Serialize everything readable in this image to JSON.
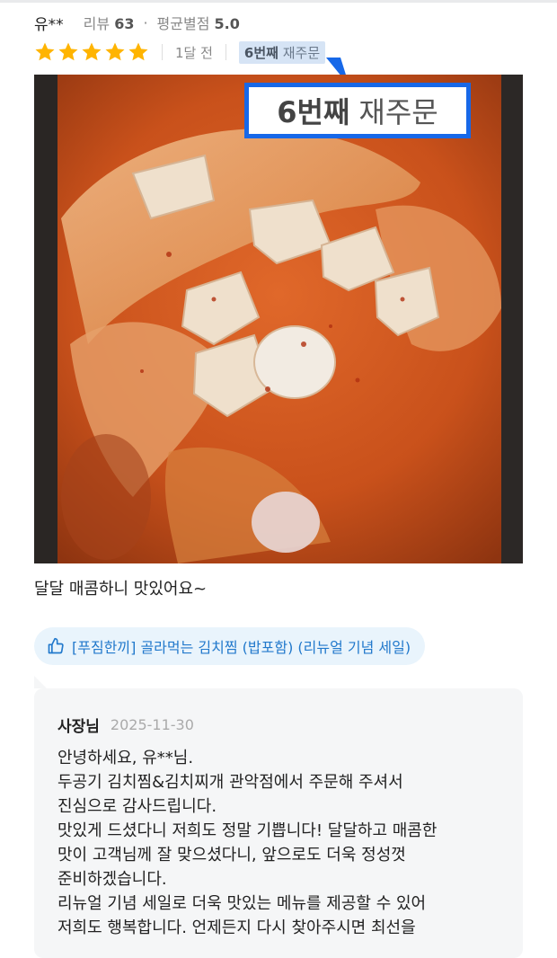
{
  "review": {
    "nickname": "유**",
    "review_count_label": "리뷰",
    "review_count": "63",
    "avg_rating_label": "평균별점",
    "avg_rating": "5.0",
    "stars": 5,
    "star_color": "#ffb400",
    "time_ago": "1달 전",
    "reorder_count": "6번째",
    "reorder_label": "재주문",
    "text": "달달 매콤하니 맛있어요~"
  },
  "menu_chip": {
    "label": "[푸짐한끼] 골라먹는 김치찜 (밥포함) (리뉴얼 기념 세일)",
    "icon": "thumbs-up-icon"
  },
  "reply": {
    "author": "사장님",
    "date": "2025-11-30",
    "lines": [
      "안녕하세요, 유**님.",
      "두공기 김치찜&김치찌개 관악점에서 주문해 주셔서",
      "진심으로 감사드립니다.",
      "맛있게 드셨다니 저희도 정말 기쁩니다! 달달하고 매콤한",
      "맛이 고객님께 잘 맞으셨다니, 앞으로도 더욱 정성껏",
      "준비하겠습니다.",
      "리뉴얼 기념 세일로 더욱 맛있는 메뉴를 제공할 수 있어",
      "저희도 행복합니다. 언제든지 다시 찾아주시면 최선을"
    ]
  },
  "colors": {
    "accent_blue": "#1768e8",
    "chip_bg": "#e9f4fc",
    "chip_text": "#2279cc"
  }
}
